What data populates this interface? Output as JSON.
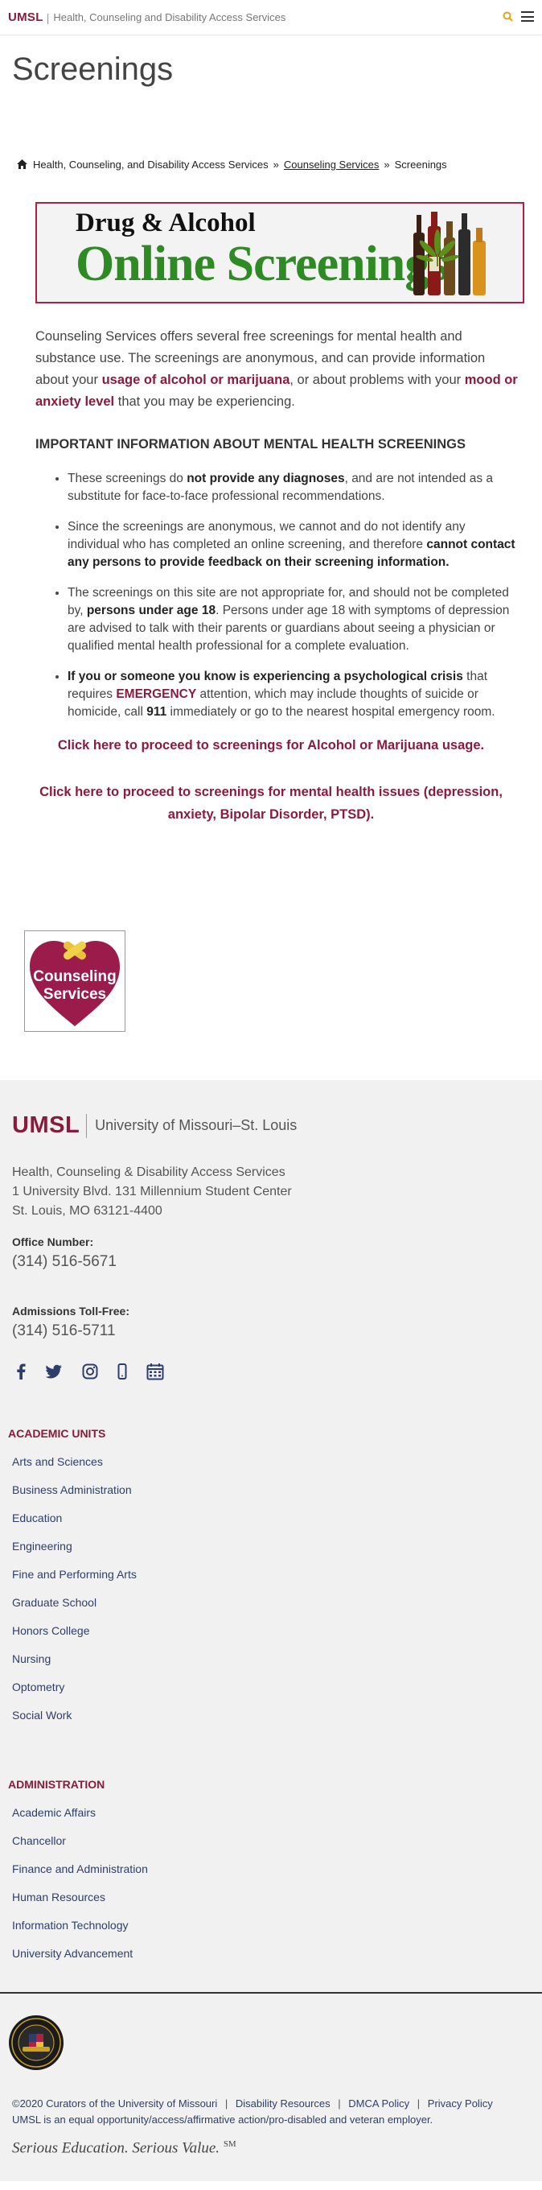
{
  "header": {
    "brand": "UMSL",
    "separator": "|",
    "unit_name": "Health, Counseling and Disability Access Services"
  },
  "page_title": "Screenings",
  "breadcrumb": {
    "home": "Health, Counseling, and Disability Access Services",
    "sep": "»",
    "parent": "Counseling Services",
    "current": "Screenings"
  },
  "banner": {
    "line1": "Drug & Alcohol",
    "line2": "Online Screenings"
  },
  "intro": {
    "p1": "Counseling Services offers several free screenings for mental health and substance use.  The screenings are anonymous, and can provide information about your ",
    "link1": "usage of alcohol or marijuana",
    "p2": ", or about problems with your ",
    "link2": "mood or anxiety level",
    "p3": " that you may be experiencing."
  },
  "important_heading": "IMPORTANT INFORMATION ABOUT MENTAL HEALTH SCREENINGS",
  "notes": {
    "n1a": "These screenings do ",
    "n1b": "not provide any diagnoses",
    "n1c": ", and are not intended as a substitute for face-to-face professional recommendations.",
    "n2a": "Since the screenings are anonymous, we cannot and do not identify any individual who has completed an online screening, and therefore ",
    "n2b": "cannot contact any persons to provide feedback on their screening information.",
    "n3a": "The screenings on this site are not appropriate for, and should not be completed by, ",
    "n3b": "persons under age 18",
    "n3c": ". Persons under age 18 with symptoms of depression are advised to talk with their parents or guardians about seeing a physician or qualified mental health professional for a complete evaluation.",
    "n4a": "If you or someone you know is experiencing a psychological crisis",
    "n4b": " that requires ",
    "n4c": "EMERGENCY",
    "n4d": " attention, which may include thoughts of suicide or homicide, call ",
    "n4e": "911",
    "n4f": " immediately or go to the nearest hospital emergency room."
  },
  "links": {
    "alcohol": "Click here to proceed to screenings for Alcohol or Marijuana usage.",
    "mental": "Click here to proceed to screenings for mental health issues (depression, anxiety, Bipolar Disorder, PTSD)."
  },
  "cs_logo": {
    "line1": "Counseling",
    "line2": "Services"
  },
  "footer": {
    "logo": "UMSL",
    "university": "University of Missouri–St. Louis",
    "address": [
      "Health, Counseling & Disability Access Services",
      "1 University Blvd. 131 Millennium Student Center",
      "St. Louis, MO 63121-4400"
    ],
    "office_label": "Office Number:",
    "office_phone": "(314) 516-5671",
    "admissions_label": "Admissions Toll-Free:",
    "admissions_phone": "(314) 516-5711",
    "social_icons": [
      "facebook-icon",
      "twitter-icon",
      "instagram-icon",
      "mobile-icon",
      "calendar-icon"
    ],
    "academic_heading": "ACADEMIC UNITS",
    "academic_units": [
      "Arts and Sciences",
      "Business Administration",
      "Education",
      "Engineering",
      "Fine and Performing Arts",
      "Graduate School",
      "Honors College",
      "Nursing",
      "Optometry",
      "Social Work"
    ],
    "admin_heading": "ADMINISTRATION",
    "admin_units": [
      "Academic Affairs",
      "Chancellor",
      "Finance and Administration",
      "Human Resources",
      "Information Technology",
      "University Advancement"
    ],
    "copyright": "©2020",
    "curators": "Curators of the University of Missouri",
    "disability": "Disability Resources",
    "dmca": "DMCA Policy",
    "privacy": "Privacy Policy",
    "sep": "|",
    "eoe": "UMSL is an equal opportunity/access/affirmative action/pro-disabled and veteran employer.",
    "slogan": "Serious Education. Serious Value.",
    "slogan_mark": "SM"
  },
  "colors": {
    "brand": "#8b1b3d",
    "link_navy": "#2d3e6b",
    "banner_green": "#2e8b23",
    "search_icon": "#e8a317"
  }
}
